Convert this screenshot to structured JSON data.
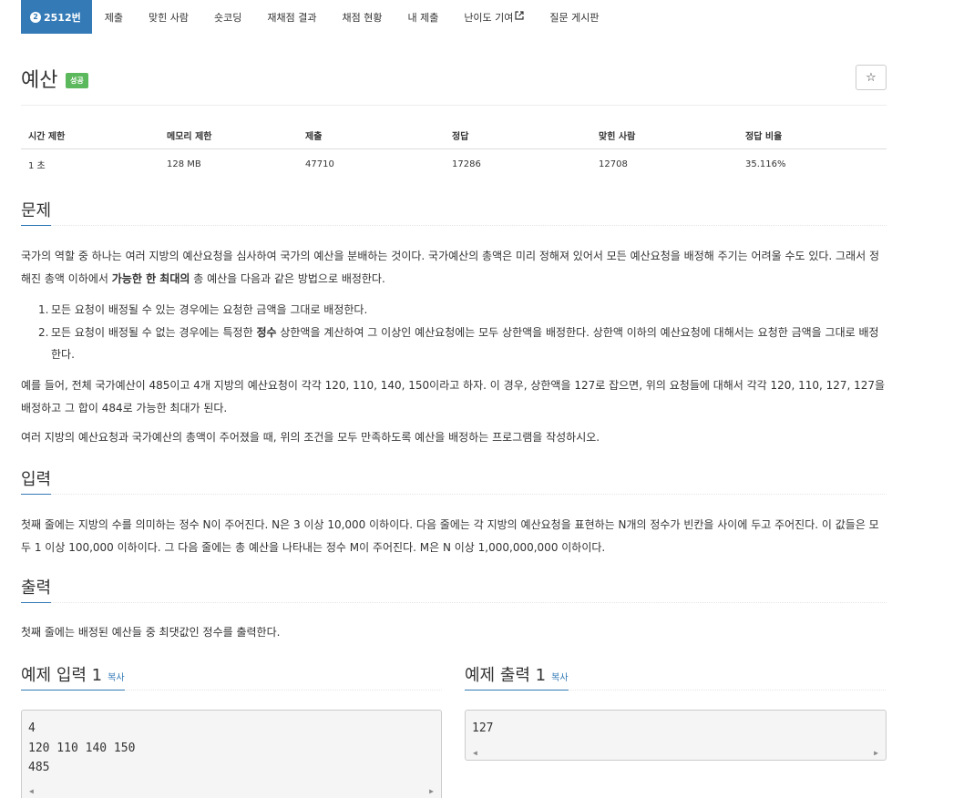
{
  "nav": {
    "problem_tab": {
      "level_icon": "2",
      "label": "2512번"
    },
    "items": [
      "제출",
      "맞힌 사람",
      "숏코딩",
      "재채점 결과",
      "채점 현황",
      "내 제출",
      "난이도 기여",
      "질문 게시판"
    ]
  },
  "title": "예산",
  "badge": "성공",
  "star_icon": "☆",
  "info": {
    "headers": [
      "시간 제한",
      "메모리 제한",
      "제출",
      "정답",
      "맞힌 사람",
      "정답 비율"
    ],
    "values": [
      "1 초",
      "128 MB",
      "47710",
      "17286",
      "12708",
      "35.116%"
    ]
  },
  "sections": {
    "problem": "문제",
    "input": "입력",
    "output": "출력"
  },
  "problem": {
    "p1_a": "국가의 역할 중 하나는 여러 지방의 예산요청을 심사하여 국가의 예산을 분배하는 것이다. 국가예산의 총액은 미리 정해져 있어서 모든 예산요청을 배정해 주기는 어려울 수도 있다. 그래서 정해진 총액 이하에서 ",
    "p1_bold": "가능한 한 최대의",
    "p1_b": " 총 예산을 다음과 같은 방법으로 배정한다.",
    "rule1": "모든 요청이 배정될 수 있는 경우에는 요청한 금액을 그대로 배정한다.",
    "rule2_a": "모든 요청이 배정될 수 없는 경우에는 특정한 ",
    "rule2_bold": "정수",
    "rule2_b": " 상한액을 계산하여 그 이상인 예산요청에는 모두 상한액을 배정한다. 상한액 이하의 예산요청에 대해서는 요청한 금액을 그대로 배정한다.",
    "p2": "예를 들어, 전체 국가예산이 485이고 4개 지방의 예산요청이 각각 120, 110, 140, 150이라고 하자. 이 경우, 상한액을 127로 잡으면, 위의 요청들에 대해서 각각 120, 110, 127, 127을 배정하고 그 합이 484로 가능한 최대가 된다.",
    "p3": "여러 지방의 예산요청과 국가예산의 총액이 주어졌을 때, 위의 조건을 모두 만족하도록 예산을 배정하는 프로그램을 작성하시오."
  },
  "input_text": "첫째 줄에는 지방의 수를 의미하는 정수 N이 주어진다. N은 3 이상 10,000 이하이다. 다음 줄에는 각 지방의 예산요청을 표현하는 N개의 정수가 빈칸을 사이에 두고 주어진다. 이 값들은 모두 1 이상 100,000 이하이다. 그 다음 줄에는 총 예산을 나타내는 정수 M이 주어진다. M은 N 이상 1,000,000,000 이하이다.",
  "output_text": "첫째 줄에는 배정된 예산들 중 최댓값인 정수를 출력한다.",
  "samples": {
    "input_title": "예제 입력 1",
    "output_title": "예제 출력 1",
    "copy_label": "복사",
    "input_data": "4\n120 110 140 150\n485",
    "output_data": "127"
  }
}
